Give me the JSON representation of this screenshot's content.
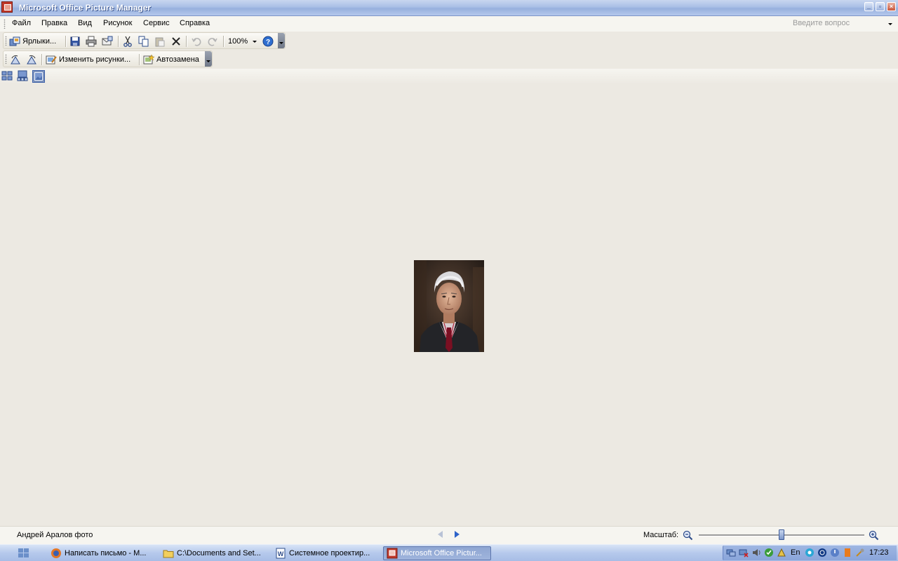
{
  "window": {
    "title": "Microsoft Office Picture Manager"
  },
  "menu": {
    "items": [
      {
        "label": "Файл"
      },
      {
        "label": "Правка"
      },
      {
        "label": "Вид"
      },
      {
        "label": "Рисунок"
      },
      {
        "label": "Сервис"
      },
      {
        "label": "Справка"
      }
    ],
    "help_placeholder": "Введите вопрос"
  },
  "toolbar1": {
    "shortcuts_label": "Ярлыки...",
    "zoom_value": "100%",
    "icons": [
      "shortcuts-icon",
      "save-icon",
      "print-icon",
      "email-icon",
      "cut-icon",
      "copy-icon",
      "paste-icon",
      "delete-icon",
      "undo-icon",
      "redo-icon",
      "help-icon"
    ]
  },
  "toolbar2": {
    "edit_label": "Изменить рисунки...",
    "autocorrect_label": "Автозамена",
    "icons": [
      "rotate-left-icon",
      "rotate-right-icon",
      "edit-pictures-icon",
      "autocorrect-icon"
    ]
  },
  "views": [
    "thumbnail-view-icon",
    "filmstrip-view-icon",
    "single-picture-view-icon"
  ],
  "status": {
    "file_name": "Андрей Аралов фото",
    "zoom_label": "Масштаб:",
    "zoom_level": 0.5
  },
  "taskbar": {
    "tasks": [
      {
        "label": "Написать письмо - М..."
      },
      {
        "label": "C:\\Documents and Set..."
      },
      {
        "label": "Системное проектир..."
      },
      {
        "label": "Microsoft Office Pictur..."
      }
    ],
    "language": "En",
    "clock": "17:23"
  },
  "colors": {
    "titlebar": "#a9bfe6",
    "workspace": "#ece9e2",
    "taskbar": "#b6c9ec"
  }
}
